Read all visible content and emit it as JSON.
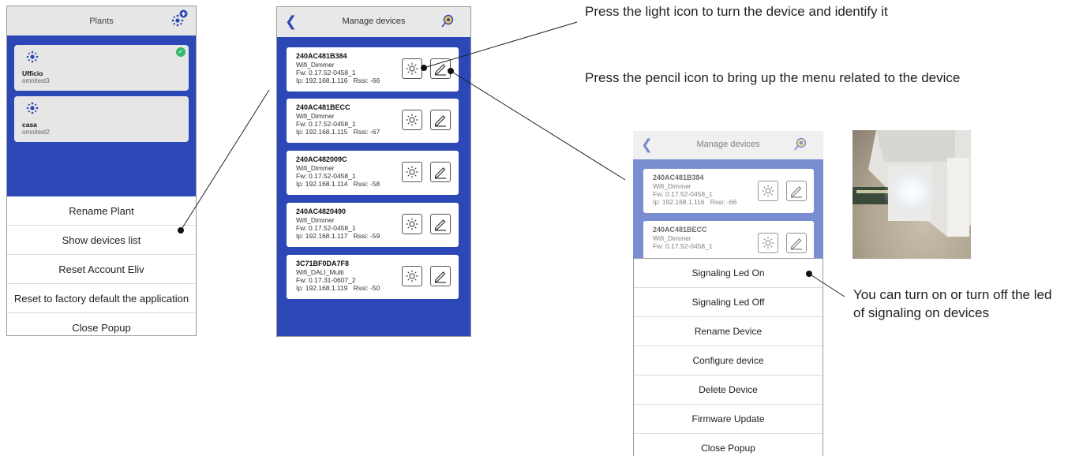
{
  "plants_screen": {
    "title": "Plants",
    "plants": [
      {
        "name": "Ufficio",
        "user": "omnitest3",
        "selected": true
      },
      {
        "name": "casa",
        "user": "omnitest2",
        "selected": false
      }
    ],
    "popup_menu": [
      "Rename Plant",
      "Show devices list",
      "Reset Account Eliv",
      "Reset to factory default the application",
      "Close Popup"
    ]
  },
  "devices_screen": {
    "title": "Manage devices",
    "devices": [
      {
        "id": "240AC481B384",
        "type": "Wifi_Dimmer",
        "fw": "Fw: 0.17.52-0458_1",
        "ip": "Ip: 192.168.1.116",
        "rssi": "Rssi: -66"
      },
      {
        "id": "240AC481BECC",
        "type": "Wifi_Dimmer",
        "fw": "Fw: 0.17.52-0458_1",
        "ip": "Ip: 192.168.1.115",
        "rssi": "Rssi: -67"
      },
      {
        "id": "240AC482009C",
        "type": "Wifi_Dimmer",
        "fw": "Fw: 0.17.52-0458_1",
        "ip": "Ip: 192.168.1.114",
        "rssi": "Rssi: -58"
      },
      {
        "id": "240AC4820490",
        "type": "Wifi_Dimmer",
        "fw": "Fw: 0.17.52-0458_1",
        "ip": "Ip: 192.168.1.117",
        "rssi": "Rssi: -59"
      },
      {
        "id": "3C71BF0DA7F8",
        "type": "Wifi_DALI_Multi",
        "fw": "Fw: 0.17.31-0607_2",
        "ip": "Ip: 192.168.1.119",
        "rssi": "Rssi: -50"
      }
    ]
  },
  "device_menu_screen": {
    "title": "Manage devices",
    "devices": [
      {
        "id": "240AC481B384",
        "type": "Wifi_Dimmer",
        "fw": "Fw: 0.17.52-0458_1",
        "ip": "Ip: 192.168.1.116",
        "rssi": "Rssi: -66"
      },
      {
        "id": "240AC481BECC",
        "type": "Wifi_Dimmer",
        "fw": "Fw: 0.17.52-0458_1"
      }
    ],
    "popup_menu": [
      "Signaling Led On",
      "Signaling Led Off",
      "Rename Device",
      "Configure device",
      "Delete Device",
      "Firmware Update",
      "Close Popup"
    ]
  },
  "annotations": {
    "light_icon": "Press the light icon to turn the device and identify it",
    "pencil_icon": "Press the pencil icon to bring up the menu related to the device",
    "signaling_led": "You can turn on or turn off the led of signaling on devices"
  },
  "colors": {
    "primary_blue": "#2c48b6",
    "header_gray": "#e6e6e6",
    "check_green": "#37b76b"
  },
  "icons": [
    "add-plant-icon",
    "network-icon",
    "check-icon",
    "back-arrow-icon",
    "locate-icon",
    "light-icon",
    "pencil-icon"
  ]
}
